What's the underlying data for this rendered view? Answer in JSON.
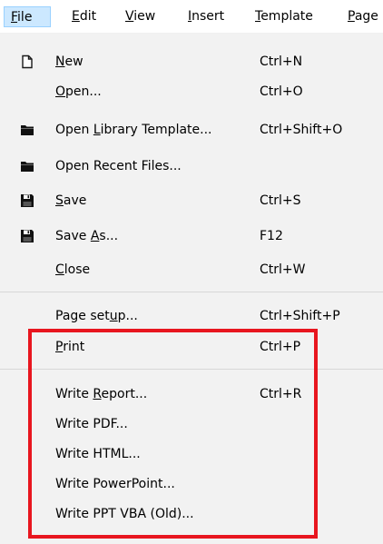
{
  "menubar": {
    "items": [
      {
        "pre": "",
        "ul": "F",
        "post": "ile"
      },
      {
        "pre": "",
        "ul": "E",
        "post": "dit"
      },
      {
        "pre": "",
        "ul": "V",
        "post": "iew"
      },
      {
        "pre": "",
        "ul": "I",
        "post": "nsert"
      },
      {
        "pre": "",
        "ul": "T",
        "post": "emplate"
      },
      {
        "pre": "",
        "ul": "P",
        "post": "age"
      }
    ]
  },
  "file_menu": {
    "items": [
      {
        "icon": "blank-document-icon",
        "pre": "",
        "ul": "N",
        "post": "ew",
        "shortcut": "Ctrl+N"
      },
      {
        "icon": "",
        "pre": "",
        "ul": "O",
        "post": "pen...",
        "shortcut": "Ctrl+O"
      },
      {
        "icon": "folder-icon",
        "pre": "Open ",
        "ul": "L",
        "post": "ibrary Template...",
        "shortcut": "Ctrl+Shift+O"
      },
      {
        "icon": "folder-icon",
        "pre": "Open Recent Files...",
        "ul": "",
        "post": "",
        "shortcut": ""
      },
      {
        "icon": "floppy-disk-icon",
        "pre": "",
        "ul": "S",
        "post": "ave",
        "shortcut": "Ctrl+S"
      },
      {
        "icon": "floppy-disk-icon",
        "pre": "Save ",
        "ul": "A",
        "post": "s...",
        "shortcut": "F12"
      },
      {
        "icon": "",
        "pre": "",
        "ul": "C",
        "post": "lose",
        "shortcut": "Ctrl+W"
      },
      {
        "icon": "",
        "pre": "Page set",
        "ul": "u",
        "post": "p...",
        "shortcut": "Ctrl+Shift+P"
      },
      {
        "icon": "",
        "pre": "",
        "ul": "P",
        "post": "rint",
        "shortcut": "Ctrl+P"
      },
      {
        "icon": "",
        "pre": "Write ",
        "ul": "R",
        "post": "eport...",
        "shortcut": "Ctrl+R"
      },
      {
        "icon": "",
        "pre": "Write PDF...",
        "ul": "",
        "post": "",
        "shortcut": ""
      },
      {
        "icon": "",
        "pre": "Write HTML...",
        "ul": "",
        "post": "",
        "shortcut": ""
      },
      {
        "icon": "",
        "pre": "Write PowerPoint...",
        "ul": "",
        "post": "",
        "shortcut": ""
      },
      {
        "icon": "",
        "pre": "Write PPT VBA (Old)...",
        "ul": "",
        "post": "",
        "shortcut": ""
      }
    ]
  },
  "colors": {
    "highlight_border": "#e8161f",
    "menu_background": "#f2f2f2",
    "active_menu_background": "#cce8ff"
  }
}
